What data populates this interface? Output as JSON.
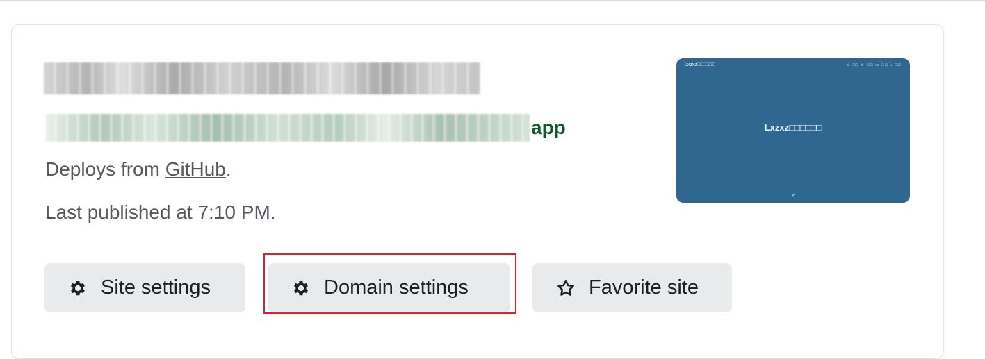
{
  "site": {
    "url_suffix": "app",
    "deploys_prefix": "Deploys from ",
    "deploys_source": "GitHub",
    "deploys_suffix": ".",
    "published": "Last published at 7:10 PM."
  },
  "preview": {
    "brand": "Lxzxz□□□□□□",
    "nav": "⌂ □□ ♬ □□ ▭ □□ ◒ □□",
    "title": "Lxzxz□□□□□□",
    "chevron": "⌄"
  },
  "buttons": {
    "site_settings": "Site settings",
    "domain_settings": "Domain settings",
    "favorite_site": "Favorite site"
  },
  "icons": {
    "site_settings": "gear-icon",
    "domain_settings": "gear-icon",
    "favorite_site": "star-outline-icon"
  },
  "colors": {
    "accent_url": "#135a2c",
    "preview_bg": "#2f6790",
    "button_bg": "#e9eaec",
    "highlight": "#e41e2a"
  }
}
